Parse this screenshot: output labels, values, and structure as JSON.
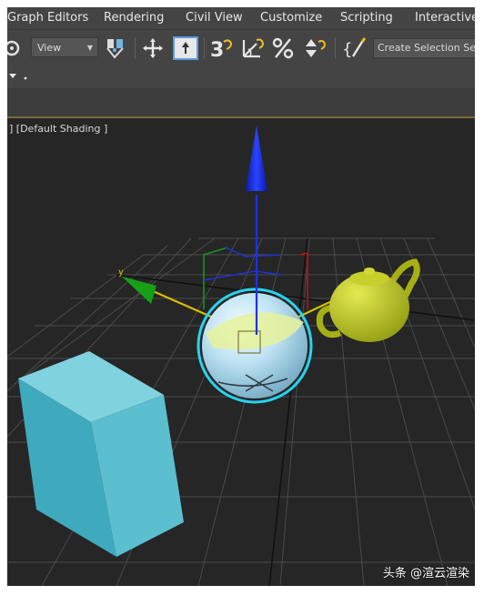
{
  "menu": {
    "items": [
      "Graph Editors",
      "Rendering",
      "Civil View",
      "Customize",
      "Scripting",
      "Interactive"
    ]
  },
  "toolbar": {
    "view_dropdown": "View",
    "snap_label": "3",
    "selection_set_placeholder": "Create Selection Se"
  },
  "viewport": {
    "label": "] [Default Shading ]"
  },
  "watermark": "头条 @渲云渲染",
  "colors": {
    "ui_panel": "#444444",
    "viewport_bg": "#262626",
    "selection_highlight": "#27d4f0",
    "axis_x": "#d01010",
    "axis_y": "#18a018",
    "axis_z": "#1020e0",
    "box": "#4cb7c9",
    "teapot": "#b9c41f"
  },
  "icons": [
    "selection-filter-icon",
    "select-object-icon",
    "select-move-icon",
    "snap-toggle-icon",
    "angle-snap-icon",
    "percent-snap-icon",
    "spinner-snap-icon",
    "named-selection-edit-icon"
  ]
}
